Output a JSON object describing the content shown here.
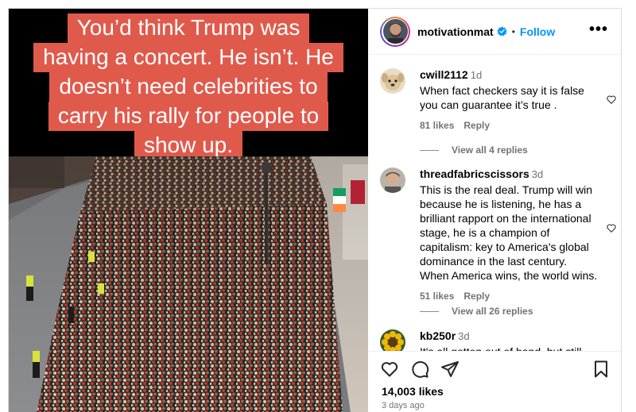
{
  "media": {
    "caption_lines": [
      "You’d think Trump was",
      "having a concert. He isn’t. He",
      "doesn’t need celebrities to",
      "carry his rally for people to",
      "show up."
    ],
    "caption_bg": "#e05a4c"
  },
  "header": {
    "username": "motivationmat",
    "verified": true,
    "separator": "•",
    "follow_label": "Follow",
    "more_label": "•••",
    "accent": "#0095f6"
  },
  "comments": [
    {
      "user": "cwill2112",
      "time": "1d",
      "text": "When fact checkers say it is false you can guarantee it’s true .",
      "likes": "81 likes",
      "reply": "Reply",
      "view_replies": "View all 4 replies"
    },
    {
      "user": "threadfabricscissors",
      "time": "3d",
      "text": "This is the real deal. Trump will win because he is listening, he has a brilliant rapport on the international stage, he is a champion of capitalism: key to America's global dominance in the last century. When America wins, the world wins.",
      "likes": "51 likes",
      "reply": "Reply",
      "view_replies": "View all 26 replies"
    },
    {
      "user": "kb250r",
      "time": "3d",
      "text": "It's all gotten out of hand, but still you"
    }
  ],
  "footer": {
    "likes": "14,003 likes",
    "posted": "3 days ago",
    "icons": [
      "heart-icon",
      "comment-icon",
      "share-icon",
      "bookmark-icon"
    ]
  }
}
